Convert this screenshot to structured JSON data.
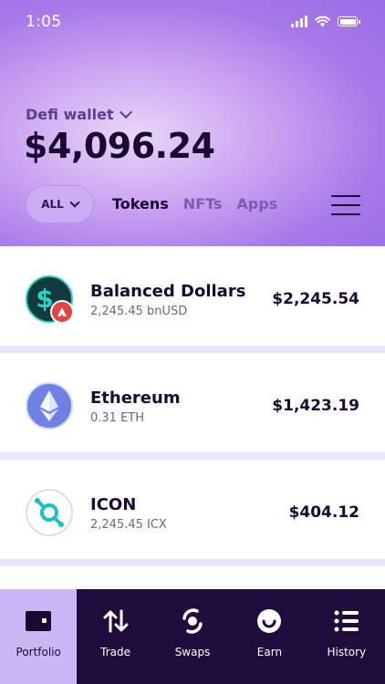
{
  "status": {
    "time": "1:05"
  },
  "wallet": {
    "name": "Defi wallet",
    "balance": "$4,096.24"
  },
  "filter": {
    "selected": "ALL"
  },
  "tabs": [
    {
      "label": "Tokens",
      "active": true
    },
    {
      "label": "NFTs",
      "active": false
    },
    {
      "label": "Apps",
      "active": false
    }
  ],
  "tokens": [
    {
      "name": "Balanced Dollars",
      "amount": "2,245.45 bnUSD",
      "value": "$2,245.54",
      "icon": "balanced-dollars-icon"
    },
    {
      "name": "Ethereum",
      "amount": "0.31 ETH",
      "value": "$1,423.19",
      "icon": "ethereum-icon"
    },
    {
      "name": "ICON",
      "amount": "2,245.45 ICX",
      "value": "$404.12",
      "icon": "icon-token-icon"
    }
  ],
  "nav": [
    {
      "label": "Portfolio",
      "icon": "wallet-icon",
      "active": true
    },
    {
      "label": "Trade",
      "icon": "trade-arrows-icon",
      "active": false
    },
    {
      "label": "Swaps",
      "icon": "swaps-icon",
      "active": false
    },
    {
      "label": "Earn",
      "icon": "smile-icon",
      "active": false
    },
    {
      "label": "History",
      "icon": "list-icon",
      "active": false
    }
  ],
  "colors": {
    "header_gradient": "#a679e9",
    "nav_background": "#1e0c3d",
    "nav_active": "#cdb6f5",
    "text_dark": "#1a0a33",
    "icx_teal": "#1bbfc4",
    "eth_blue": "#6c7fe0",
    "avax_red": "#e84142"
  }
}
